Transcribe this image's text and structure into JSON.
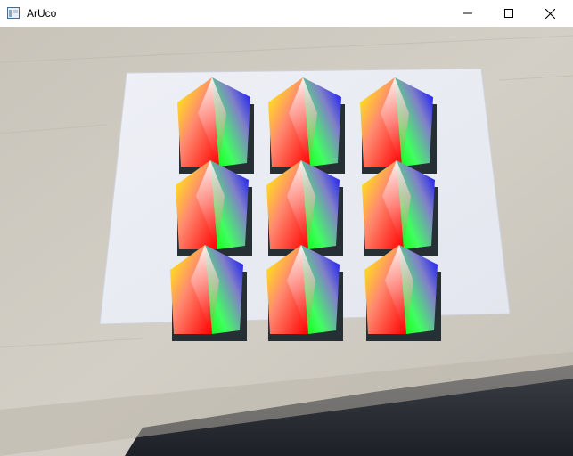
{
  "window": {
    "title": "ArUco",
    "app_icon": "opencv-window-icon",
    "controls": [
      {
        "name": "minimize-button",
        "icon": "minimize-icon"
      },
      {
        "name": "maximize-button",
        "icon": "maximize-icon"
      },
      {
        "name": "close-button",
        "icon": "close-icon"
      }
    ]
  },
  "scene": {
    "description_type": "camera-feed",
    "marker_grid": {
      "rows": 3,
      "cols": 3,
      "count": 9
    },
    "overlay_colors": {
      "yellow": "#ffff00",
      "red": "#ff0000",
      "green": "#00ff00",
      "blue": "#0000ff",
      "white": "#ffffff"
    },
    "desk_color": "#cdc8bf",
    "paper_color": "#f2f3f7"
  }
}
